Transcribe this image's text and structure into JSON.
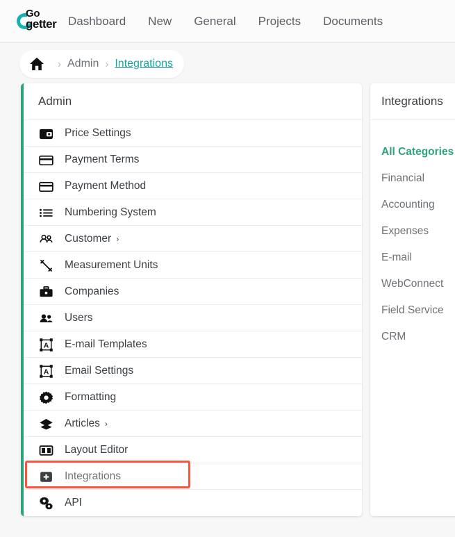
{
  "topnav": {
    "logo": {
      "line1": "Go",
      "line2": "getter",
      "icon": "gogetter-logo-icon"
    },
    "items": [
      {
        "label": "Dashboard"
      },
      {
        "label": "New"
      },
      {
        "label": "General"
      },
      {
        "label": "Projects"
      },
      {
        "label": "Documents"
      }
    ]
  },
  "breadcrumb": {
    "home_icon": "home-icon",
    "separator": "›",
    "items": [
      {
        "label": "Admin",
        "active": false
      },
      {
        "label": "Integrations",
        "active": true
      }
    ]
  },
  "sidebar": {
    "title": "Admin",
    "items": [
      {
        "label": "Price Settings",
        "icon": "wallet-icon",
        "chevron": ""
      },
      {
        "label": "Payment Terms",
        "icon": "credit-card-icon",
        "chevron": ""
      },
      {
        "label": "Payment Method",
        "icon": "credit-card-icon",
        "chevron": ""
      },
      {
        "label": "Numbering System",
        "icon": "list-icon",
        "chevron": ""
      },
      {
        "label": "Customer",
        "icon": "users-outline-icon",
        "chevron": "›"
      },
      {
        "label": "Measurement Units",
        "icon": "measure-arrow-icon",
        "chevron": ""
      },
      {
        "label": "Companies",
        "icon": "briefcase-icon",
        "chevron": ""
      },
      {
        "label": "Users",
        "icon": "users-filled-icon",
        "chevron": ""
      },
      {
        "label": "E-mail Templates",
        "icon": "text-frame-icon",
        "chevron": ""
      },
      {
        "label": "Email Settings",
        "icon": "text-frame-icon",
        "chevron": ""
      },
      {
        "label": "Formatting",
        "icon": "gear-icon",
        "chevron": ""
      },
      {
        "label": "Articles",
        "icon": "layers-icon",
        "chevron": "›"
      },
      {
        "label": "Layout Editor",
        "icon": "layout-columns-icon",
        "chevron": ""
      },
      {
        "label": "Integrations",
        "icon": "plus-square-icon",
        "chevron": "",
        "highlighted": true
      },
      {
        "label": "API",
        "icon": "double-gear-icon",
        "chevron": ""
      }
    ]
  },
  "panel": {
    "title": "Integrations",
    "categories": [
      {
        "label": "All Categories",
        "active": true
      },
      {
        "label": "Financial",
        "active": false
      },
      {
        "label": "Accounting",
        "active": false
      },
      {
        "label": "Expenses",
        "active": false
      },
      {
        "label": "E-mail",
        "active": false
      },
      {
        "label": "WebConnect",
        "active": false
      },
      {
        "label": "Field Service",
        "active": false
      },
      {
        "label": "CRM",
        "active": false
      }
    ]
  },
  "colors": {
    "accent_teal": "#16a6a2",
    "accent_green": "#2fa37a",
    "highlight_red": "#f9553f",
    "text_primary": "#3b4045",
    "text_muted": "#6d7277"
  }
}
